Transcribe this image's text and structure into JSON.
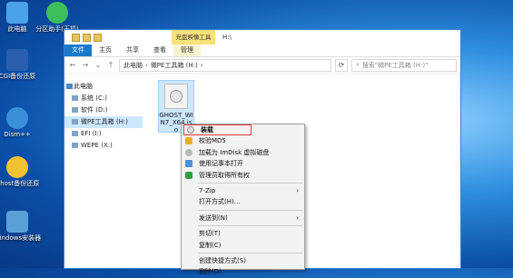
{
  "desktop": {
    "icons": [
      {
        "label": "此电脑",
        "color": "#4aa3e8"
      },
      {
        "label": "分区助手(无损)",
        "color": "#3cbf5a"
      },
      {
        "label": "CGI备份还原",
        "color": "#2a5fb0"
      },
      {
        "label": "Dism++",
        "color": "#3b8fd8"
      },
      {
        "label": "Ghost备份还原",
        "color": "#f2c230"
      },
      {
        "label": "Windows安装器",
        "color": "#5aa0d8"
      }
    ]
  },
  "window": {
    "title": "H:\\",
    "context_tab_header": "光盘映像工具",
    "ribbon_tabs": [
      "文件",
      "主页",
      "共享",
      "查看",
      "管理"
    ],
    "nav_back": "←",
    "nav_forward": "→",
    "nav_recent": "⌄",
    "nav_up": "↑",
    "address": [
      "此电脑",
      "›",
      "微PE工具箱 (H:)",
      "›"
    ],
    "refresh": "⟳",
    "search_placeholder": "搜索\"微PE工具箱 (H:)\""
  },
  "nav_pane": {
    "root": "此电脑",
    "items": [
      "系统 (C:)",
      "软件 (D:)",
      "微PE工具箱 (H:)",
      "EFI (I:)",
      "WEPE (X:)"
    ],
    "selected_index": 2
  },
  "file": {
    "name": "GHOST_WIN7_X64.iso"
  },
  "context_menu": {
    "items": [
      {
        "label": "装载",
        "highlight": true
      },
      {
        "label": "校验MD5",
        "icon": "shield-icon"
      },
      {
        "label": "加载为 ImDisk 虚拟磁盘",
        "icon": "disk-icon"
      },
      {
        "label": "使用记事本打开",
        "icon": "notepad-icon"
      },
      {
        "label": "管理员取得所有权",
        "icon": "shield-green-icon"
      },
      {
        "sep": true
      },
      {
        "label": "7-Zip",
        "submenu": true
      },
      {
        "label": "打开方式(H)..."
      },
      {
        "sep": true
      },
      {
        "label": "发送到(N)",
        "submenu": true
      },
      {
        "sep": true
      },
      {
        "label": "剪切(T)"
      },
      {
        "label": "复制(C)"
      },
      {
        "sep": true
      },
      {
        "label": "创建快捷方式(S)"
      },
      {
        "label": "删除(D)"
      }
    ]
  }
}
